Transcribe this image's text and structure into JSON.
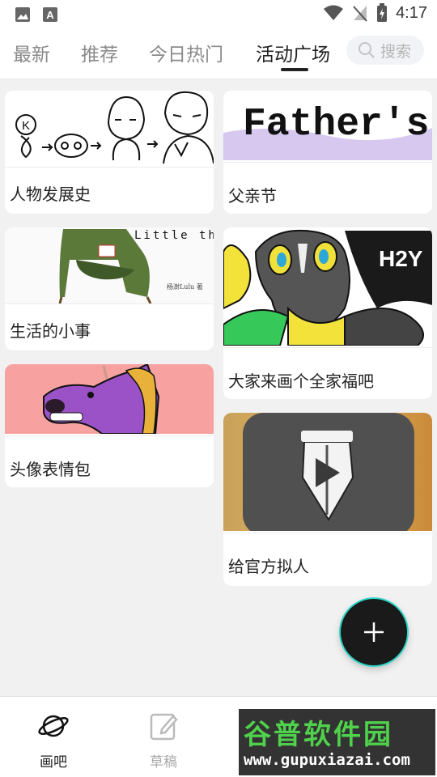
{
  "status_bar": {
    "time": "4:17",
    "icons": [
      "image-icon",
      "text-a-icon",
      "wifi-icon",
      "signal-off-icon",
      "battery-charging-icon"
    ]
  },
  "tabs": [
    {
      "label": "最新",
      "active": false
    },
    {
      "label": "推荐",
      "active": false
    },
    {
      "label": "今日热门",
      "active": false
    },
    {
      "label": "活动广场",
      "active": true
    }
  ],
  "search": {
    "placeholder": "搜索"
  },
  "cards": [
    {
      "title": "人物发展史"
    },
    {
      "title": "父亲节",
      "thumb_text": "Father's"
    },
    {
      "title": "生活的小事",
      "thumb_text": "Little things",
      "thumb_subtext": "杨澍Lulu 著"
    },
    {
      "title": "大家来画个全家福吧",
      "thumb_text": "H2Y"
    },
    {
      "title": "头像表情包"
    },
    {
      "title": "给官方拟人"
    }
  ],
  "fab": {
    "icon": "plus-icon"
  },
  "bottom_nav": [
    {
      "label": "画吧",
      "icon": "planet-icon",
      "active": true
    },
    {
      "label": "草稿",
      "icon": "edit-icon",
      "active": false
    }
  ],
  "watermark": {
    "line1": "谷普软件园",
    "line2": "www.gupuxiazai.com"
  },
  "colors": {
    "accent_ring": "#2fd6c8",
    "fab_bg": "#1a1a1a",
    "active_text": "#222222",
    "inactive_text": "#8a8a8a"
  }
}
